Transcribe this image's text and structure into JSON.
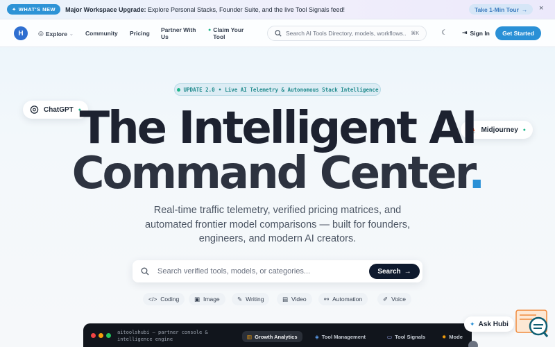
{
  "announcement": {
    "badge": "WHAT'S NEW",
    "bold": "Major Workspace Upgrade:",
    "text": "Explore Personal Stacks, Founder Suite, and the live Tool Signals feed!",
    "tour_label": "Take 1-Min Tour",
    "close": "×"
  },
  "nav": {
    "logo": "H",
    "explore": "Explore",
    "community": "Community",
    "pricing": "Pricing",
    "partner_line1": "Partner With",
    "partner_line2": "Us",
    "claim_line1": "Claim Your",
    "claim_line2": "Tool",
    "search_placeholder": "Search AI Tools Directory, models, workflows...",
    "search_kbd": "⌘K",
    "sign_in": "Sign In",
    "get_started": "Get Started"
  },
  "hero": {
    "update_version": "UPDATE 2.0",
    "update_sep": "•",
    "update_text": "Live AI Telemetry & Autonomous Stack Intelligence",
    "tag_left": "ChatGPT",
    "tag_right": "Midjourney",
    "title_line1": "The Intelligent AI",
    "title_line2": "Command Center",
    "title_dot": ".",
    "subtitle": "Real-time traffic telemetry, verified pricing matrices, and automated frontier model comparisons — built for founders, engineers, and modern AI creators.",
    "search_placeholder": "Search verified tools, models, or categories...",
    "search_button": "Search",
    "chips": [
      "Coding",
      "Image",
      "Writing",
      "Video",
      "Automation",
      "Voice"
    ]
  },
  "console": {
    "title_line1": "aitoolshubi — partner console &",
    "title_line2": "intelligence engine",
    "tabs": [
      "Growth Analytics",
      "Tool Management",
      "Tool Signals",
      "Mode"
    ]
  },
  "assistant": {
    "label": "Ask Hubi"
  },
  "colors": {
    "accent": "#2a90d6",
    "dark": "#0f1a2e",
    "live_green": "#1fb68a"
  }
}
